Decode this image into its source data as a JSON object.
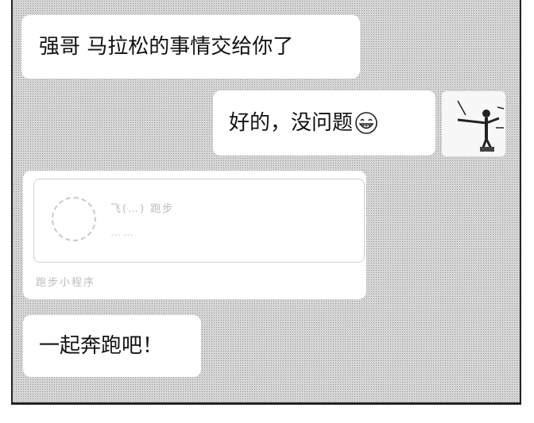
{
  "messages": {
    "m1": "强哥 马拉松的事情交给你了",
    "m2": "好的，没问题",
    "m4": "一起奔跑吧！"
  },
  "card": {
    "title": "飞(…) 跑步",
    "subtitle": "……",
    "footer": "跑步小程序"
  },
  "icons": {
    "emoji": "grinning-face-icon",
    "avatar": "sports-figure-avatar"
  }
}
